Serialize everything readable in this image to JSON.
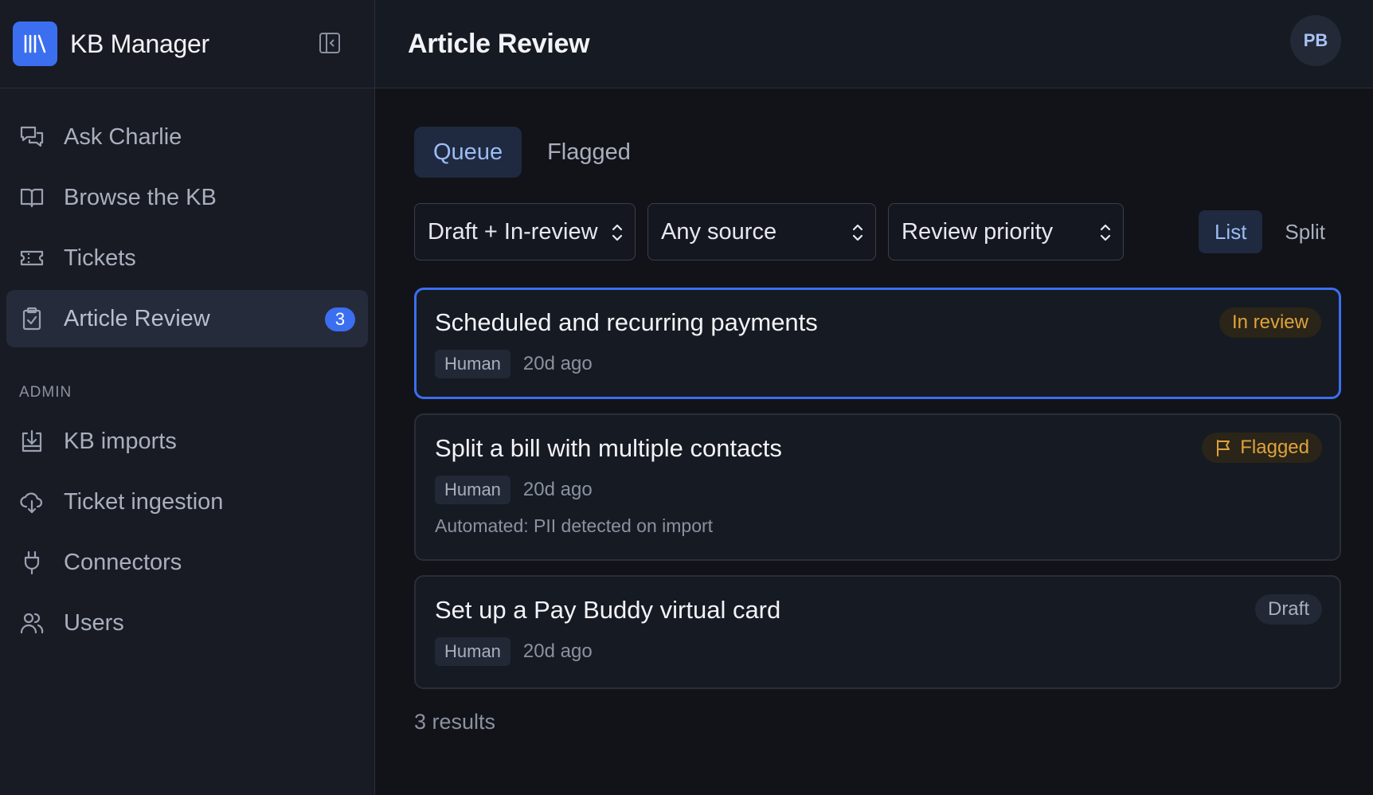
{
  "sidebar": {
    "brand": "KB Manager",
    "items": [
      {
        "label": "Ask Charlie",
        "icon": "chat-bubbles-icon"
      },
      {
        "label": "Browse the KB",
        "icon": "open-book-icon"
      },
      {
        "label": "Tickets",
        "icon": "ticket-icon"
      },
      {
        "label": "Article Review",
        "icon": "clipboard-check-icon",
        "badge": "3",
        "active": true
      }
    ],
    "admin_label": "ADMIN",
    "admin_items": [
      {
        "label": "KB imports",
        "icon": "import-tray-icon"
      },
      {
        "label": "Ticket ingestion",
        "icon": "cloud-download-icon"
      },
      {
        "label": "Connectors",
        "icon": "plug-icon"
      },
      {
        "label": "Users",
        "icon": "users-icon"
      }
    ]
  },
  "header": {
    "title": "Article Review",
    "avatar": "PB"
  },
  "tabs": [
    {
      "label": "Queue",
      "active": true
    },
    {
      "label": "Flagged",
      "active": false
    }
  ],
  "filters": {
    "status": "Draft + In-review",
    "source": "Any source",
    "sort": "Review priority"
  },
  "view": {
    "list": "List",
    "split": "Split"
  },
  "articles": [
    {
      "title": "Scheduled and recurring payments",
      "source": "Human",
      "age": "20d ago",
      "status": "In review",
      "note": ""
    },
    {
      "title": "Split a bill with multiple contacts",
      "source": "Human",
      "age": "20d ago",
      "status": "Flagged",
      "note": "Automated: PII detected on import"
    },
    {
      "title": "Set up a Pay Buddy virtual card",
      "source": "Human",
      "age": "20d ago",
      "status": "Draft",
      "note": ""
    }
  ],
  "results": "3 results",
  "colors": {
    "accent": "#3b6ff0",
    "warning": "#e0a23c",
    "background": "#111318",
    "sidebar": "#181b24"
  }
}
